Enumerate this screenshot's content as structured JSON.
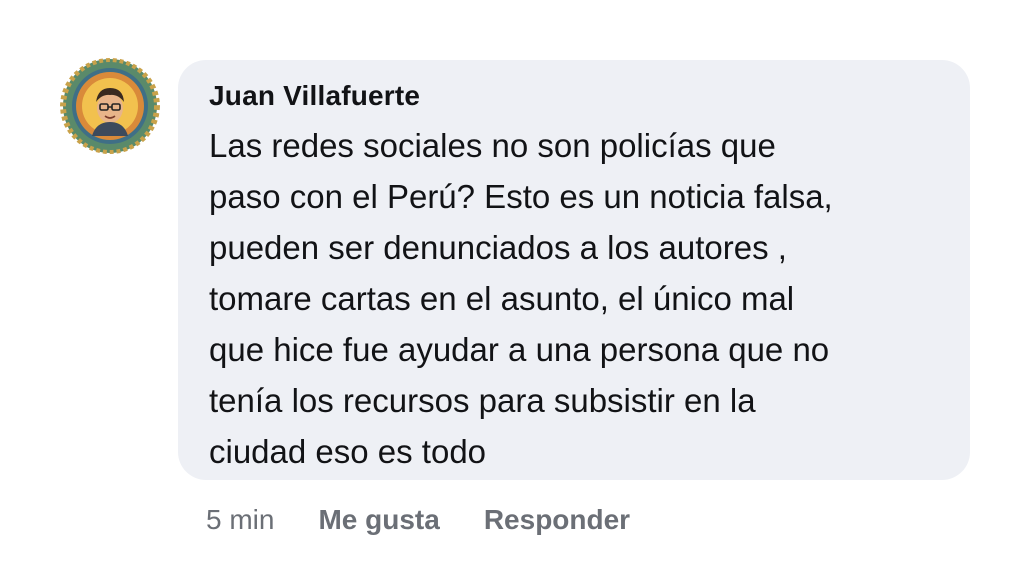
{
  "comment": {
    "author": "Juan Villafuerte",
    "lines": [
      "Las redes sociales no son policías que",
      "paso con el Perú? Esto es un noticia falsa,",
      "pueden ser denunciados a los autores ,",
      "tomare cartas en el asunto, el único mal",
      "que hice fue ayudar a una persona que no",
      "tenía los recursos para subsistir en la",
      "ciudad eso es todo"
    ],
    "avatar_icon": "user-avatar-icon"
  },
  "actions": {
    "time": "5 min",
    "like_label": "Me gusta",
    "reply_label": "Responder"
  },
  "colors": {
    "bubble_bg": "#eef0f5",
    "text": "#121316",
    "meta": "#6b6f76"
  }
}
